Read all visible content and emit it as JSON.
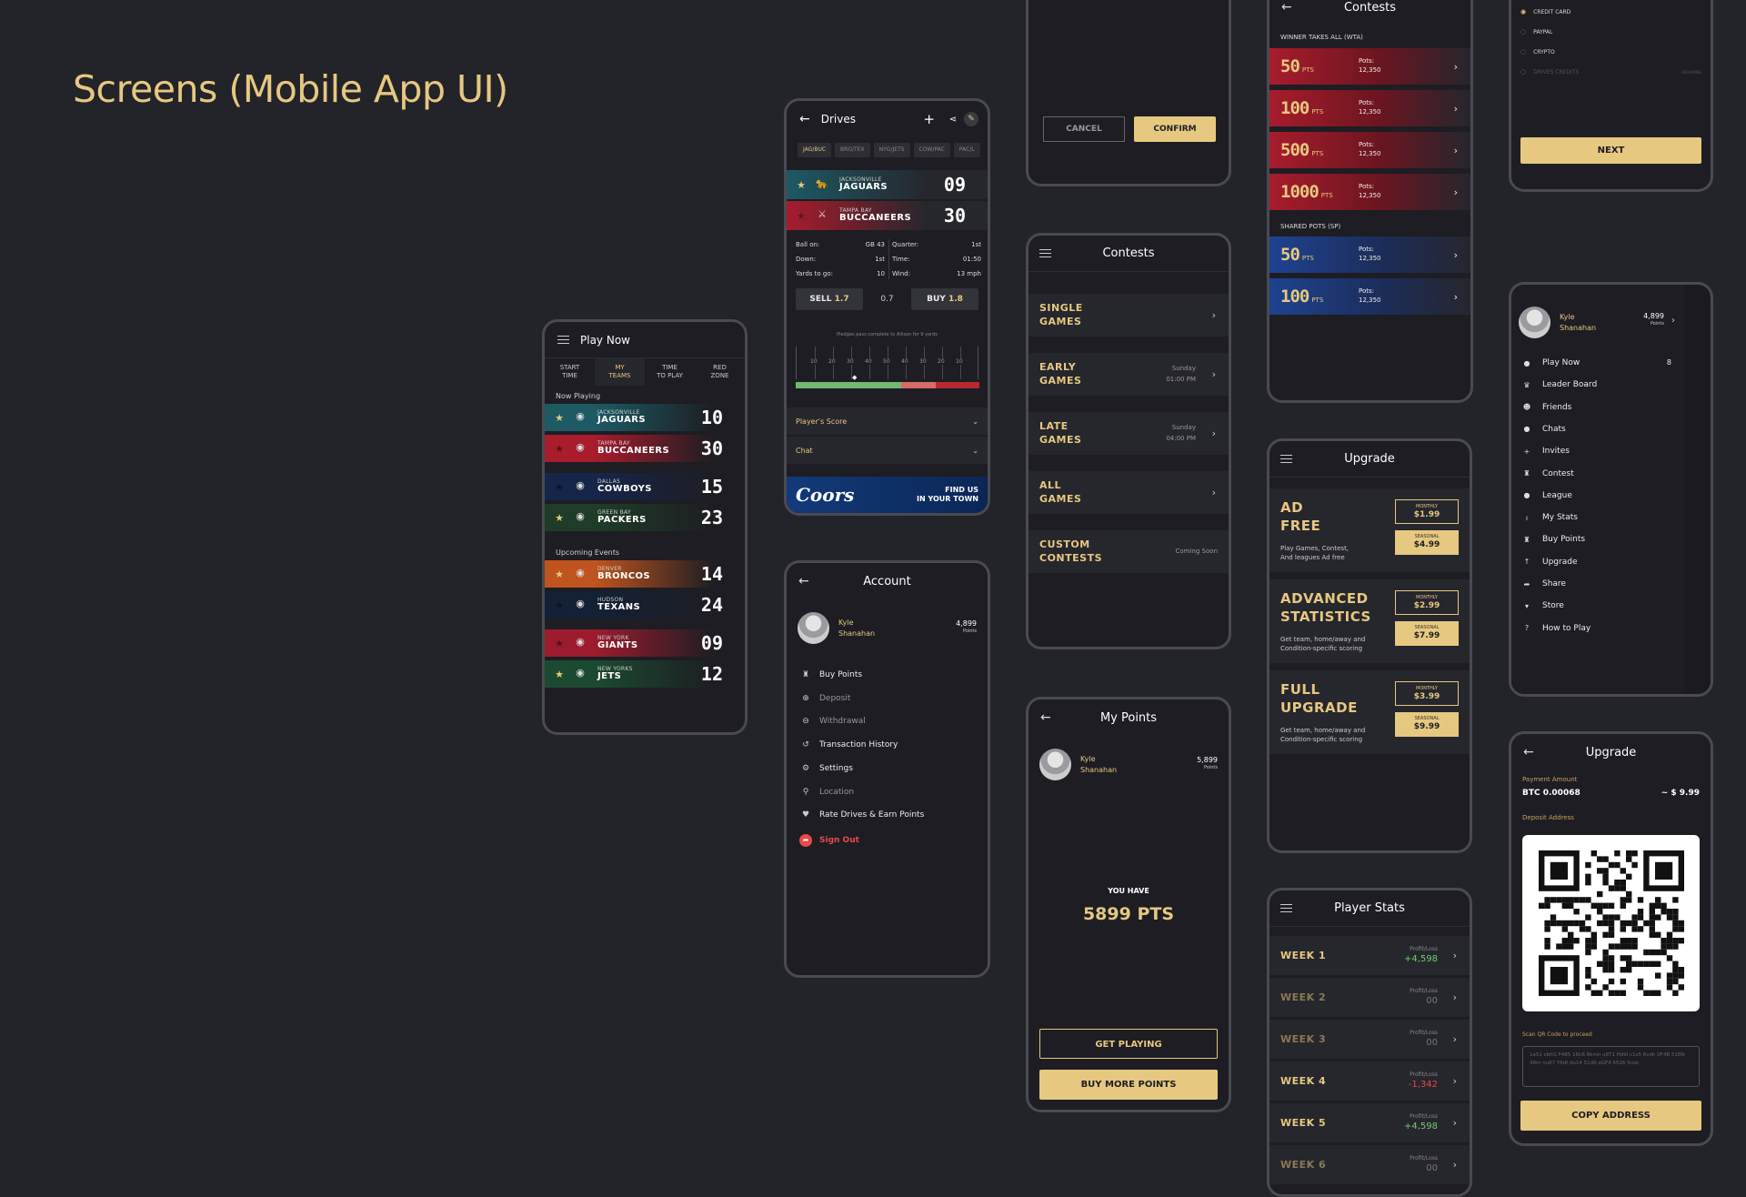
{
  "page_title": "Screens (Mobile App UI)",
  "play_now": {
    "title": "Play Now",
    "tabs": [
      "START\nTIME",
      "MY\nTEAMS",
      "TIME\nTO PLAY",
      "RED\nZONE"
    ],
    "now_playing_label": "Now Playing",
    "upcoming_label": "Upcoming Events",
    "now_playing": [
      {
        "city": "JACKSONVILLE",
        "team": "JAGUARS",
        "score": "10",
        "star": true,
        "color": "#1d5a64"
      },
      {
        "city": "TAMPA BAY",
        "team": "BUCCANEERS",
        "score": "30",
        "star": false,
        "color": "#a81c2c"
      },
      {
        "city": "DALLAS",
        "team": "COWBOYS",
        "score": "15",
        "star": false,
        "color": "#16254a"
      },
      {
        "city": "GREEN BAY",
        "team": "PACKERS",
        "score": "23",
        "star": true,
        "color": "#1f3c28"
      }
    ],
    "upcoming": [
      {
        "city": "DENVER",
        "team": "BRONCOS",
        "score": "14",
        "star": true,
        "color": "#c0541e"
      },
      {
        "city": "HUDSON",
        "team": "TEXANS",
        "score": "24",
        "star": false,
        "color": "#142035"
      },
      {
        "city": "NEW YORK",
        "team": "GIANTS",
        "score": "09",
        "star": false,
        "color": "#9c1c2e"
      },
      {
        "city": "NEW YORKS",
        "team": "JETS",
        "score": "12",
        "star": true,
        "color": "#1c4a30"
      }
    ]
  },
  "drives": {
    "title": "Drives",
    "tabs": [
      "JAG/BUC",
      "BRO/TEX",
      "NYG/JETS",
      "COW/PAC",
      "PAC/L"
    ],
    "team1": {
      "city": "JACKSONVILLE",
      "team": "JAGUARS",
      "score": "09"
    },
    "team2": {
      "city": "TAMPA BAY",
      "team": "BUCCANEERS",
      "score": "30"
    },
    "stats_left": [
      [
        "Ball on:",
        "GB 43"
      ],
      [
        "Down:",
        "1st"
      ],
      [
        "Yards to go:",
        "10"
      ]
    ],
    "stats_right": [
      [
        "Quarter:",
        "1st"
      ],
      [
        "Time:",
        "01:50"
      ],
      [
        "Wind:",
        "13 mph"
      ]
    ],
    "sell_label": "SELL",
    "sell_value": "1.7",
    "spread": "0.7",
    "buy_label": "BUY",
    "buy_value": "1.8",
    "field_caption": "Pledges pass complete to Allison for 9 yards",
    "yard_marks": [
      "10",
      "20",
      "30",
      "40",
      "50",
      "40",
      "30",
      "20",
      "10"
    ],
    "section1": "Player's Score",
    "section2": "Chat",
    "ad_brand": "Coors",
    "ad_text": "FIND US\nIN YOUR TOWN"
  },
  "confirm_top": {
    "cancel": "CANCEL",
    "confirm": "CONFIRM"
  },
  "contests_menu": {
    "title": "Contests",
    "items": [
      {
        "label": "SINGLE\nGAMES",
        "meta": ""
      },
      {
        "label": "EARLY\nGAMES",
        "meta": "Sunday\n01:00 PM"
      },
      {
        "label": "LATE\nGAMES",
        "meta": "Sunday\n04:00 PM"
      },
      {
        "label": "ALL\nGAMES",
        "meta": ""
      },
      {
        "label": "CUSTOM\nCONTESTS",
        "meta": "Coming Soon"
      }
    ]
  },
  "contests_pots": {
    "title": "Contests",
    "wta_label": "WINNER TAKES ALL (WTA)",
    "shared_label": "SHARED POTS (SP)",
    "pots_label": "Pots:",
    "pts_suffix": "PTS",
    "wta": [
      {
        "amount": "50",
        "pots": "12,350"
      },
      {
        "amount": "100",
        "pots": "12,350"
      },
      {
        "amount": "500",
        "pots": "12,350"
      },
      {
        "amount": "1000",
        "pots": "12,350"
      }
    ],
    "shared": [
      {
        "amount": "50",
        "pots": "12,350"
      },
      {
        "amount": "100",
        "pots": "12,350"
      }
    ]
  },
  "payment": {
    "options": [
      "CREDIT CARD",
      "PAYPAL",
      "CRYPTO",
      "DRIVES CREDITS"
    ],
    "drives_credits_tag": "UPCOMING",
    "next": "NEXT"
  },
  "account": {
    "title": "Account",
    "name": "Kyle\nShanahan",
    "points": "4,899",
    "points_label": "Points",
    "items": [
      {
        "label": "Buy Points",
        "icon": "bag-icon",
        "dim": false,
        "red": false
      },
      {
        "label": "Deposit",
        "icon": "plus-circle-icon",
        "dim": true,
        "red": false
      },
      {
        "label": "Withdrawal",
        "icon": "minus-circle-icon",
        "dim": true,
        "red": false
      },
      {
        "label": "Transaction History",
        "icon": "history-icon",
        "dim": false,
        "red": false
      },
      {
        "label": "Settings",
        "icon": "gear-icon",
        "dim": false,
        "red": false
      },
      {
        "label": "Location",
        "icon": "pin-icon",
        "dim": true,
        "red": false
      },
      {
        "label": "Rate Drives & Earn Points",
        "icon": "heart-icon",
        "dim": false,
        "red": false
      },
      {
        "label": "Sign Out",
        "icon": "signout-icon",
        "dim": false,
        "red": true
      }
    ]
  },
  "my_points": {
    "title": "My Points",
    "name": "Kyle\nShanahan",
    "points": "5,899",
    "points_label": "Points",
    "you_have": "YOU HAVE",
    "big": "5899 PTS",
    "get_playing": "GET PLAYING",
    "buy_more": "BUY MORE POINTS"
  },
  "upgrade_plans": {
    "title": "Upgrade",
    "monthly_label": "MONTHLY",
    "seasonal_label": "SEASONAL",
    "plans": [
      {
        "name": "AD\nFREE",
        "desc": "Play Games, Contest,\nAnd leagues Ad free",
        "monthly": "$1.99",
        "seasonal": "$4.99"
      },
      {
        "name": "ADVANCED\nSTATISTICS",
        "desc": "Get team, home/away and\nCondition-specific scoring",
        "monthly": "$2.99",
        "seasonal": "$7.99"
      },
      {
        "name": "FULL\nUPGRADE",
        "desc": "Get team, home/away and\nCondition-specific scoring",
        "monthly": "$3.99",
        "seasonal": "$9.99"
      }
    ]
  },
  "player_stats": {
    "title": "Player Stats",
    "pl_label": "Profit/Loss",
    "weeks": [
      {
        "label": "WEEK 1",
        "value": "+4,598",
        "state": "pos"
      },
      {
        "label": "WEEK 2",
        "value": "00",
        "state": "dim"
      },
      {
        "label": "WEEK 3",
        "value": "00",
        "state": "dim"
      },
      {
        "label": "WEEK 4",
        "value": "-1,342",
        "state": "neg"
      },
      {
        "label": "WEEK 5",
        "value": "+4,598",
        "state": "pos"
      },
      {
        "label": "WEEK 6",
        "value": "00",
        "state": "dim"
      }
    ]
  },
  "side_menu": {
    "name": "Kyle\nShanahan",
    "points": "4,899",
    "points_label": "Points",
    "badge": "8",
    "items": [
      {
        "label": "Play Now",
        "icon": "football-icon"
      },
      {
        "label": "Leader Board",
        "icon": "crown-icon"
      },
      {
        "label": "Friends",
        "icon": "friends-icon"
      },
      {
        "label": "Chats",
        "icon": "chat-icon"
      },
      {
        "label": "Invites",
        "icon": "plus-icon"
      },
      {
        "label": "Contest",
        "icon": "trophy-icon"
      },
      {
        "label": "League",
        "icon": "league-icon"
      },
      {
        "label": "My Stats",
        "icon": "stats-icon"
      },
      {
        "label": "Buy Points",
        "icon": "bag-icon"
      },
      {
        "label": "Upgrade",
        "icon": "arrow-up-icon"
      },
      {
        "label": "Share",
        "icon": "share-icon"
      },
      {
        "label": "Store",
        "icon": "cart-icon"
      },
      {
        "label": "How to Play",
        "icon": "question-icon"
      }
    ]
  },
  "upgrade_crypto": {
    "title": "Upgrade",
    "payment_amount_label": "Payment Amount",
    "btc": "BTC 0.00068",
    "usd": "~ $ 9.99",
    "deposit_label": "Deposit Address",
    "scan_label": "Scan QR Code to proceed",
    "address": "1e51 cbhG F485 16h6 8kmn u8T1 Hd9l c1s5 8vdh 0F4B 51BN 48m nu87 Y6df du14 51d6 eGF4 6516 9usk",
    "copy": "COPY ADDRESS"
  }
}
